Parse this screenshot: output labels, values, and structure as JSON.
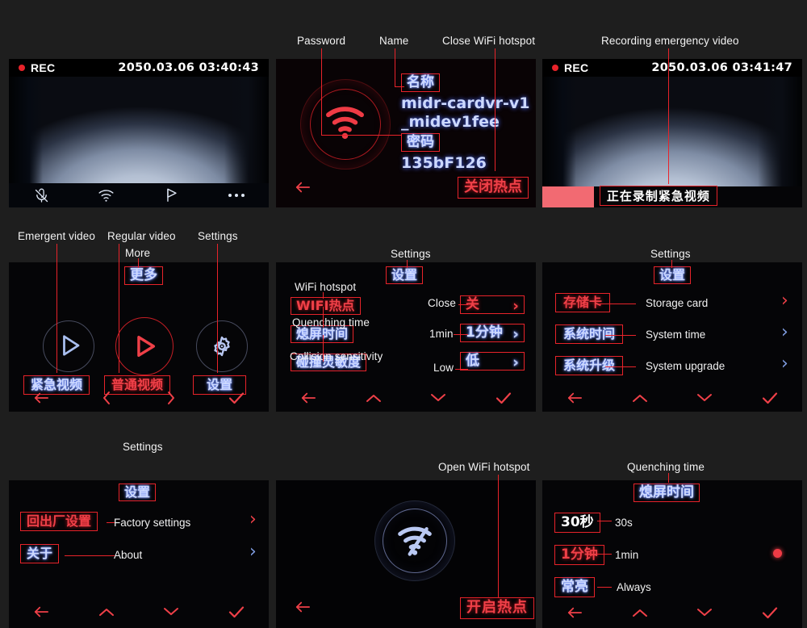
{
  "page": {
    "background": "#1e1e1e",
    "accent_red": "#e8232a",
    "accent_blue": "#cdd9ff"
  },
  "panels": [
    {
      "id": "live-recording",
      "annotations": [],
      "status_bar": {
        "rec_label": "REC",
        "timestamp": "2050.03.06 03:40:43"
      },
      "toolbar_icons": [
        "mute-mic-icon",
        "wifi-icon",
        "flag-icon",
        "more-dots-icon"
      ]
    },
    {
      "id": "wifi-hotspot-on",
      "annotations": [
        {
          "name": "annotation-password",
          "text": "Password"
        },
        {
          "name": "annotation-name",
          "text": "Name"
        },
        {
          "name": "annotation-close-wifi-hotspot",
          "text": "Close WiFi hotspot"
        }
      ],
      "name_tag": "名称",
      "ssid": "midr-cardvr-v1_midev1fee",
      "ssid_line1": "midr-cardvr-v1",
      "ssid_line2": "_midev1fee",
      "password_tag": "密码",
      "password": "135bF126",
      "close_hotspot_button": "关闭热点",
      "back_icon": "back-arrow-icon",
      "wifi_icon": "wifi-on-icon"
    },
    {
      "id": "emergency-recording",
      "annotations": [
        {
          "name": "annotation-recording-emergency-video",
          "text": "Recording emergency video"
        }
      ],
      "status_bar": {
        "rec_label": "REC",
        "timestamp": "2050.03.06 03:41:47"
      },
      "emergency_banner": "正在录制紧急视频"
    },
    {
      "id": "main-menu",
      "annotations": [
        {
          "name": "annotation-emergent-video",
          "text": "Emergent video"
        },
        {
          "name": "annotation-regular-video",
          "text": "Regular video"
        },
        {
          "name": "annotation-settings",
          "text": "Settings"
        },
        {
          "name": "annotation-more",
          "text": "More"
        }
      ],
      "more_tag": "更多",
      "items": [
        {
          "label": "紧急视频",
          "icon": "play-triangle-icon",
          "en": "Emergent video"
        },
        {
          "label": "普通视频",
          "icon": "play-circle-icon",
          "en": "Regular video"
        },
        {
          "label": "设置",
          "icon": "gear-icon",
          "en": "Settings"
        }
      ],
      "nav": [
        "back-arrow-icon",
        "chevron-left-icon",
        "chevron-right-icon",
        "check-icon"
      ]
    },
    {
      "id": "settings-page-1",
      "annotations": [
        {
          "name": "annotation-settings",
          "text": "Settings"
        },
        {
          "name": "annotation-wifi-hotspot",
          "text": "WiFi hotspot"
        },
        {
          "name": "annotation-quenching-time",
          "text": "Quenching time"
        },
        {
          "name": "annotation-collision-sensitivity",
          "text": "Collision sensitivity"
        },
        {
          "name": "annotation-close",
          "text": "Close"
        },
        {
          "name": "annotation-1min",
          "text": "1min"
        },
        {
          "name": "annotation-low",
          "text": "Low"
        }
      ],
      "title": "设置",
      "rows": [
        {
          "label": "WIFI热点",
          "label_en": "WiFi hotspot",
          "value": "关",
          "value_en": "Close"
        },
        {
          "label": "熄屏时间",
          "label_en": "Quenching time",
          "value": "1分钟",
          "value_en": "1min"
        },
        {
          "label": "碰撞灵敏度",
          "label_en": "Collision sensitivity",
          "value": "低",
          "value_en": "Low"
        }
      ],
      "nav": [
        "back-arrow-icon",
        "chevron-up-icon",
        "chevron-down-icon",
        "check-icon"
      ]
    },
    {
      "id": "settings-page-2",
      "annotations": [
        {
          "name": "annotation-settings",
          "text": "Settings"
        }
      ],
      "title": "设置",
      "rows": [
        {
          "label": "存储卡",
          "label_en": "Storage card"
        },
        {
          "label": "系统时间",
          "label_en": "System time"
        },
        {
          "label": "系统升级",
          "label_en": "System upgrade"
        }
      ],
      "nav": [
        "back-arrow-icon",
        "chevron-up-icon",
        "chevron-down-icon",
        "check-icon"
      ]
    },
    {
      "id": "settings-page-3",
      "annotations": [
        {
          "name": "annotation-settings",
          "text": "Settings"
        }
      ],
      "title": "设置",
      "rows": [
        {
          "label": "回出厂设置",
          "label_en": "Factory settings"
        },
        {
          "label": "关于",
          "label_en": "About"
        }
      ],
      "nav": [
        "back-arrow-icon",
        "chevron-up-icon",
        "chevron-down-icon",
        "check-icon"
      ]
    },
    {
      "id": "wifi-hotspot-off",
      "annotations": [
        {
          "name": "annotation-open-wifi-hotspot",
          "text": "Open WiFi hotspot"
        }
      ],
      "open_hotspot_button": "开启热点",
      "back_icon": "back-arrow-icon",
      "wifi_icon": "wifi-off-icon"
    },
    {
      "id": "quenching-time-page",
      "annotations": [
        {
          "name": "annotation-quenching-time",
          "text": "Quenching time"
        },
        {
          "name": "annotation-30s",
          "text": "30s"
        },
        {
          "name": "annotation-1min",
          "text": "1min"
        },
        {
          "name": "annotation-always",
          "text": "Always"
        }
      ],
      "title": "熄屏时间",
      "options": [
        {
          "label": "30秒",
          "label_en": "30s",
          "selected": false
        },
        {
          "label": "1分钟",
          "label_en": "1min",
          "selected": true
        },
        {
          "label": "常亮",
          "label_en": "Always",
          "selected": false
        }
      ],
      "nav": [
        "back-arrow-icon",
        "chevron-up-icon",
        "chevron-down-icon",
        "check-icon"
      ]
    }
  ]
}
